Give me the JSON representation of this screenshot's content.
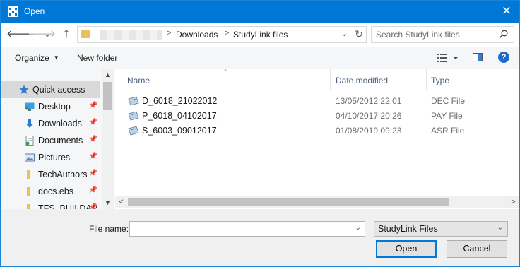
{
  "titlebar": {
    "title": "Open",
    "close_glyph": "✕"
  },
  "nav": {
    "back": "🡐",
    "forward": "🡒",
    "recent": "⌄",
    "up": "🡑"
  },
  "address": {
    "crumbs": [
      "Downloads",
      "StudyLink files"
    ],
    "separator": ">",
    "dropdown_glyph": "⌄",
    "refresh_glyph": "↻"
  },
  "search": {
    "placeholder": "Search StudyLink files"
  },
  "toolbar": {
    "organize_label": "Organize",
    "caret": "▼",
    "new_folder_label": "New folder",
    "help_glyph": "?"
  },
  "sidebar": {
    "items": [
      {
        "label": "Quick access",
        "icon": "star-icon",
        "selected": true,
        "pinned": false
      },
      {
        "label": "Desktop",
        "icon": "desktop-icon",
        "selected": false,
        "pinned": true
      },
      {
        "label": "Downloads",
        "icon": "download-icon",
        "selected": false,
        "pinned": true
      },
      {
        "label": "Documents",
        "icon": "documents-icon",
        "selected": false,
        "pinned": true
      },
      {
        "label": "Pictures",
        "icon": "pictures-icon",
        "selected": false,
        "pinned": true
      },
      {
        "label": "TechAuthors",
        "icon": "folder-icon",
        "selected": false,
        "pinned": true
      },
      {
        "label": "docs.ebs",
        "icon": "folder-icon",
        "selected": false,
        "pinned": true
      },
      {
        "label": "TFS_BUILDAP",
        "icon": "folder-icon",
        "selected": false,
        "pinned": true
      }
    ],
    "pin_glyph": "📌"
  },
  "filelist": {
    "columns": [
      "Name",
      "Date modified",
      "Type"
    ],
    "sort_glyph": "^",
    "rows": [
      {
        "name": "D_6018_21022012",
        "date": "13/05/2012 22:01",
        "type": "DEC File"
      },
      {
        "name": "P_6018_04102017",
        "date": "04/10/2017 20:26",
        "type": "PAY File"
      },
      {
        "name": "S_6003_09012017",
        "date": "01/08/2019 09:23",
        "type": "ASR File"
      }
    ],
    "scroll_left": "<",
    "scroll_right": ">"
  },
  "bottom": {
    "filename_label": "File name:",
    "filename_value": "",
    "filter_value": "StudyLink Files",
    "open_label": "Open",
    "cancel_label": "Cancel",
    "dropdown_glyph": "⌄"
  },
  "colors": {
    "accent": "#0078d7",
    "nav_bg": "#f5f6f7",
    "selected_bg": "#d9d9d9"
  }
}
